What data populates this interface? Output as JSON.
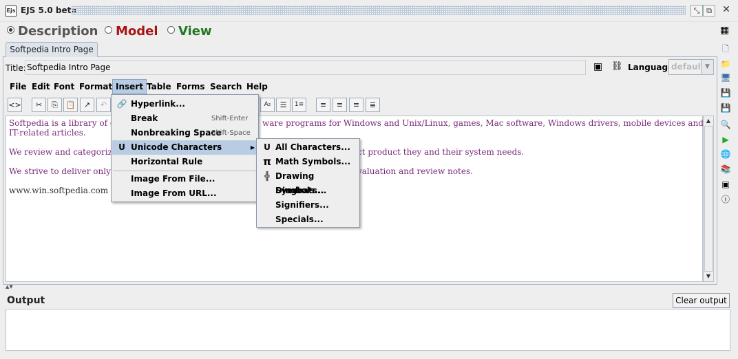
{
  "window": {
    "title": "EJS 5.0 beta",
    "logo": "Ejs"
  },
  "modes": {
    "description": "Description",
    "model": "Model",
    "view": "View"
  },
  "colors": {
    "description": "#555555",
    "model": "#aa1111",
    "view": "#227722"
  },
  "tab": {
    "label": "Softpedia Intro Page"
  },
  "title_field": {
    "label": "Title:",
    "value": "Softpedia Intro Page"
  },
  "language": {
    "label": "Language:",
    "value": "default"
  },
  "menubar": [
    "File",
    "Edit",
    "Font",
    "Format",
    "Insert",
    "Table",
    "Forms",
    "Search",
    "Help"
  ],
  "editor": {
    "lines": [
      "Softpedia is a library of ov",
      "IT-related articles.",
      "We review and categorize",
      "We strive to deliver only t",
      "www.win.softpedia.com"
    ],
    "lines_right": [
      "ware  programs for Windows and Unix/Linux, games, Mac software, Windows drivers, mobile devices and",
      "ct product they and their system needs.",
      "valuation and review notes."
    ]
  },
  "insert_menu": [
    {
      "label": "Hyperlink...",
      "shortcut": "",
      "icon": "link-icon"
    },
    {
      "label": "Break",
      "shortcut": "Shift-Enter",
      "icon": ""
    },
    {
      "label": "Nonbreaking Space",
      "shortcut": "Shift-Space",
      "icon": ""
    },
    {
      "label": "Unicode Characters",
      "shortcut": "",
      "icon": "unicode-icon"
    },
    {
      "label": "Horizontal Rule",
      "shortcut": "",
      "icon": ""
    },
    {
      "label": "Image From File...",
      "shortcut": "",
      "icon": ""
    },
    {
      "label": "Image From URL...",
      "shortcut": "",
      "icon": ""
    }
  ],
  "unicode_submenu": [
    {
      "label": "All Characters...",
      "icon": "unicode-icon"
    },
    {
      "label": "Math Symbols...",
      "icon": "pi-icon"
    },
    {
      "label": "Drawing Symbols...",
      "icon": "drawing-symbol-icon"
    },
    {
      "label": "Dingbats...",
      "icon": ""
    },
    {
      "label": "Signifiers...",
      "icon": ""
    },
    {
      "label": "Specials...",
      "icon": ""
    }
  ],
  "output": {
    "label": "Output",
    "clear_label": "Clear output",
    "content": ""
  }
}
